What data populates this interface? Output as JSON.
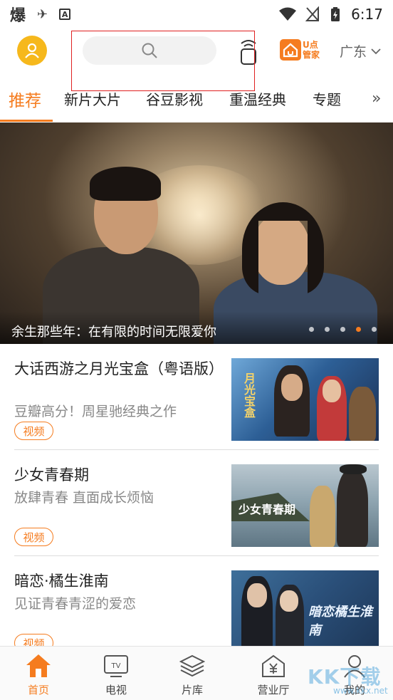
{
  "status_bar": {
    "app_glyph": "爆",
    "time": "6:17"
  },
  "header": {
    "upoint_line1": "U点",
    "upoint_line2": "管家",
    "region": "广东"
  },
  "tabs": [
    {
      "label": "推荐",
      "active": true
    },
    {
      "label": "新片大片"
    },
    {
      "label": "谷豆影视"
    },
    {
      "label": "重温经典"
    },
    {
      "label": "专题"
    }
  ],
  "tabs_more": "»",
  "banner": {
    "caption": "余生那些年：在有限的时间无限爱你",
    "dot_count": 5,
    "active_dot": 4
  },
  "items": [
    {
      "title": "大话西游之月光宝盒（粤语版）",
      "subtitle": "豆瓣高分！周星驰经典之作",
      "tag": "视频",
      "thumb_text": "月光宝盒"
    },
    {
      "title": "少女青春期",
      "subtitle": "放肆青春 直面成长烦恼",
      "tag": "视频",
      "thumb_text": "少女青春期"
    },
    {
      "title": "暗恋·橘生淮南",
      "subtitle": "见证青春青涩的爱恋",
      "tag": "视频",
      "thumb_text": "暗恋橘生淮南"
    }
  ],
  "bottom_nav": [
    {
      "label": "首页",
      "icon": "home-icon",
      "active": true
    },
    {
      "label": "电视",
      "icon": "tv-icon"
    },
    {
      "label": "片库",
      "icon": "layers-icon"
    },
    {
      "label": "营业厅",
      "icon": "yuan-store-icon"
    },
    {
      "label": "我的",
      "icon": "user-icon"
    }
  ],
  "watermark": {
    "main": "KK下载",
    "sub": "www.kkx.net"
  },
  "colors": {
    "accent": "#f57c1f",
    "avatar": "#f6b81c",
    "highlight": "#e02020"
  }
}
